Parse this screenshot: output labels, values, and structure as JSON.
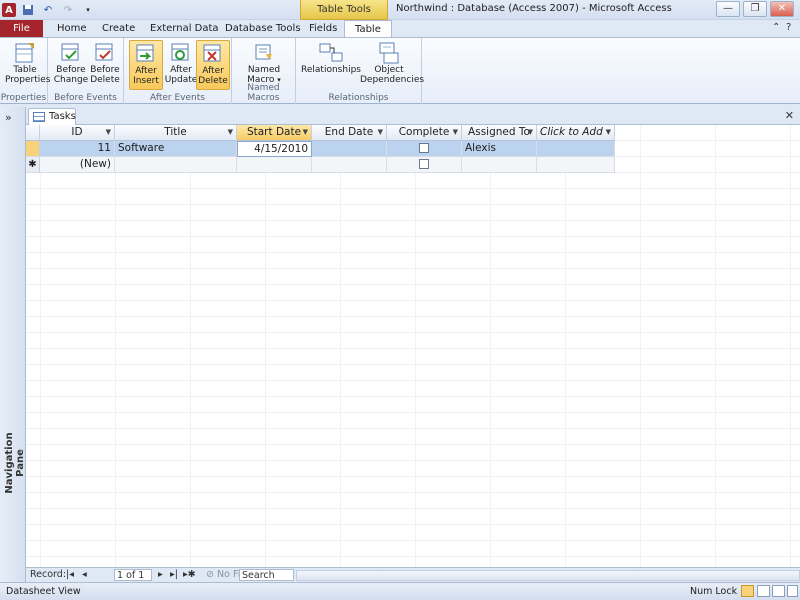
{
  "window": {
    "title": "Northwind : Database (Access 2007)  -  Microsoft Access",
    "context_tab_header": "Table Tools",
    "win_minimize": "—",
    "win_restore": "❐",
    "win_close": "✕"
  },
  "ribbon_tabs": [
    {
      "label": "File"
    },
    {
      "label": "Home"
    },
    {
      "label": "Create"
    },
    {
      "label": "External Data"
    },
    {
      "label": "Database Tools"
    },
    {
      "label": "Fields"
    },
    {
      "label": "Table"
    }
  ],
  "ribbon": {
    "groups": [
      {
        "label": "Properties"
      },
      {
        "label": "Before Events"
      },
      {
        "label": "After Events"
      },
      {
        "label": "Named Macros"
      },
      {
        "label": "Relationships"
      }
    ],
    "buttons": {
      "table_properties": "Table Properties",
      "before_change": "Before Change",
      "before_delete": "Before Delete",
      "after_insert": "After Insert",
      "after_update": "After Update",
      "after_delete": "After Delete",
      "named_macro": "Named Macro",
      "relationships": "Relationships",
      "object_dependencies": "Object Dependencies"
    }
  },
  "nav_pane": {
    "label": "Navigation Pane",
    "toggle": "»"
  },
  "doc_tab": {
    "label": "Tasks",
    "close": "✕"
  },
  "datasheet": {
    "columns": [
      {
        "label": "ID"
      },
      {
        "label": "Title"
      },
      {
        "label": "Start Date"
      },
      {
        "label": "End Date"
      },
      {
        "label": "Complete"
      },
      {
        "label": "Assigned To"
      },
      {
        "label": "Click to Add"
      }
    ],
    "rows": [
      {
        "id": "11",
        "title": "Software Development",
        "start_date": "4/15/2010",
        "end_date": "",
        "complete": false,
        "assigned_to": "Alexis"
      }
    ],
    "new_row": {
      "marker": "✱",
      "id": "(New)"
    }
  },
  "record_nav": {
    "label": "Record:",
    "position": "1 of 1",
    "filter": "No Filter",
    "search": "Search"
  },
  "status": {
    "left": "Datasheet View",
    "num_lock": "Num Lock"
  }
}
